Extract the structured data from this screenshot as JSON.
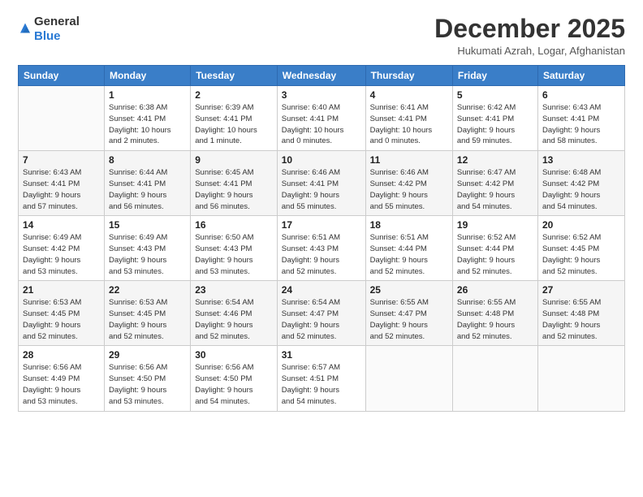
{
  "logo": {
    "general": "General",
    "blue": "Blue"
  },
  "title": {
    "month_year": "December 2025",
    "location": "Hukumati Azrah, Logar, Afghanistan"
  },
  "headers": [
    "Sunday",
    "Monday",
    "Tuesday",
    "Wednesday",
    "Thursday",
    "Friday",
    "Saturday"
  ],
  "weeks": [
    [
      {
        "day": "",
        "info": ""
      },
      {
        "day": "1",
        "info": "Sunrise: 6:38 AM\nSunset: 4:41 PM\nDaylight: 10 hours\nand 2 minutes."
      },
      {
        "day": "2",
        "info": "Sunrise: 6:39 AM\nSunset: 4:41 PM\nDaylight: 10 hours\nand 1 minute."
      },
      {
        "day": "3",
        "info": "Sunrise: 6:40 AM\nSunset: 4:41 PM\nDaylight: 10 hours\nand 0 minutes."
      },
      {
        "day": "4",
        "info": "Sunrise: 6:41 AM\nSunset: 4:41 PM\nDaylight: 10 hours\nand 0 minutes."
      },
      {
        "day": "5",
        "info": "Sunrise: 6:42 AM\nSunset: 4:41 PM\nDaylight: 9 hours\nand 59 minutes."
      },
      {
        "day": "6",
        "info": "Sunrise: 6:43 AM\nSunset: 4:41 PM\nDaylight: 9 hours\nand 58 minutes."
      }
    ],
    [
      {
        "day": "7",
        "info": "Sunrise: 6:43 AM\nSunset: 4:41 PM\nDaylight: 9 hours\nand 57 minutes."
      },
      {
        "day": "8",
        "info": "Sunrise: 6:44 AM\nSunset: 4:41 PM\nDaylight: 9 hours\nand 56 minutes."
      },
      {
        "day": "9",
        "info": "Sunrise: 6:45 AM\nSunset: 4:41 PM\nDaylight: 9 hours\nand 56 minutes."
      },
      {
        "day": "10",
        "info": "Sunrise: 6:46 AM\nSunset: 4:41 PM\nDaylight: 9 hours\nand 55 minutes."
      },
      {
        "day": "11",
        "info": "Sunrise: 6:46 AM\nSunset: 4:42 PM\nDaylight: 9 hours\nand 55 minutes."
      },
      {
        "day": "12",
        "info": "Sunrise: 6:47 AM\nSunset: 4:42 PM\nDaylight: 9 hours\nand 54 minutes."
      },
      {
        "day": "13",
        "info": "Sunrise: 6:48 AM\nSunset: 4:42 PM\nDaylight: 9 hours\nand 54 minutes."
      }
    ],
    [
      {
        "day": "14",
        "info": "Sunrise: 6:49 AM\nSunset: 4:42 PM\nDaylight: 9 hours\nand 53 minutes."
      },
      {
        "day": "15",
        "info": "Sunrise: 6:49 AM\nSunset: 4:43 PM\nDaylight: 9 hours\nand 53 minutes."
      },
      {
        "day": "16",
        "info": "Sunrise: 6:50 AM\nSunset: 4:43 PM\nDaylight: 9 hours\nand 53 minutes."
      },
      {
        "day": "17",
        "info": "Sunrise: 6:51 AM\nSunset: 4:43 PM\nDaylight: 9 hours\nand 52 minutes."
      },
      {
        "day": "18",
        "info": "Sunrise: 6:51 AM\nSunset: 4:44 PM\nDaylight: 9 hours\nand 52 minutes."
      },
      {
        "day": "19",
        "info": "Sunrise: 6:52 AM\nSunset: 4:44 PM\nDaylight: 9 hours\nand 52 minutes."
      },
      {
        "day": "20",
        "info": "Sunrise: 6:52 AM\nSunset: 4:45 PM\nDaylight: 9 hours\nand 52 minutes."
      }
    ],
    [
      {
        "day": "21",
        "info": "Sunrise: 6:53 AM\nSunset: 4:45 PM\nDaylight: 9 hours\nand 52 minutes."
      },
      {
        "day": "22",
        "info": "Sunrise: 6:53 AM\nSunset: 4:45 PM\nDaylight: 9 hours\nand 52 minutes."
      },
      {
        "day": "23",
        "info": "Sunrise: 6:54 AM\nSunset: 4:46 PM\nDaylight: 9 hours\nand 52 minutes."
      },
      {
        "day": "24",
        "info": "Sunrise: 6:54 AM\nSunset: 4:47 PM\nDaylight: 9 hours\nand 52 minutes."
      },
      {
        "day": "25",
        "info": "Sunrise: 6:55 AM\nSunset: 4:47 PM\nDaylight: 9 hours\nand 52 minutes."
      },
      {
        "day": "26",
        "info": "Sunrise: 6:55 AM\nSunset: 4:48 PM\nDaylight: 9 hours\nand 52 minutes."
      },
      {
        "day": "27",
        "info": "Sunrise: 6:55 AM\nSunset: 4:48 PM\nDaylight: 9 hours\nand 52 minutes."
      }
    ],
    [
      {
        "day": "28",
        "info": "Sunrise: 6:56 AM\nSunset: 4:49 PM\nDaylight: 9 hours\nand 53 minutes."
      },
      {
        "day": "29",
        "info": "Sunrise: 6:56 AM\nSunset: 4:50 PM\nDaylight: 9 hours\nand 53 minutes."
      },
      {
        "day": "30",
        "info": "Sunrise: 6:56 AM\nSunset: 4:50 PM\nDaylight: 9 hours\nand 54 minutes."
      },
      {
        "day": "31",
        "info": "Sunrise: 6:57 AM\nSunset: 4:51 PM\nDaylight: 9 hours\nand 54 minutes."
      },
      {
        "day": "",
        "info": ""
      },
      {
        "day": "",
        "info": ""
      },
      {
        "day": "",
        "info": ""
      }
    ]
  ]
}
